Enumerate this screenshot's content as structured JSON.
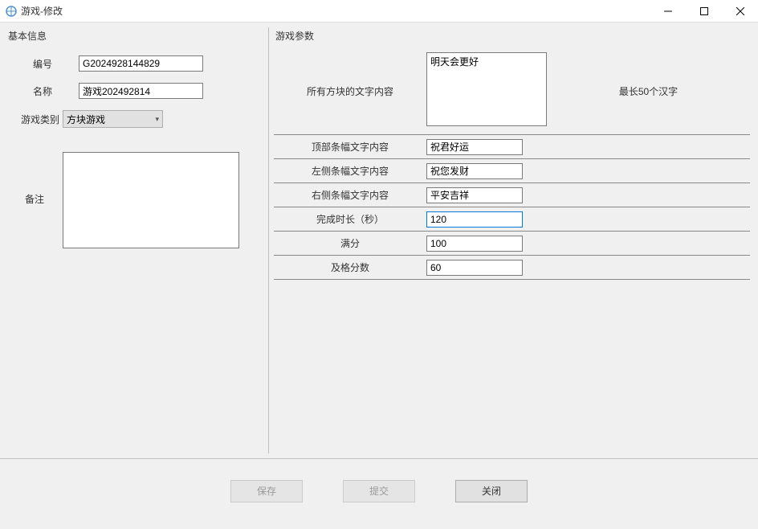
{
  "window": {
    "title": "游戏-修改"
  },
  "basicInfo": {
    "legend": "基本信息",
    "idLabel": "编号",
    "idValue": "G2024928144829",
    "nameLabel": "名称",
    "nameValue": "游戏202492814",
    "categoryLabel": "游戏类别",
    "categoryValue": "方块游戏",
    "remarksLabel": "备注",
    "remarksValue": ""
  },
  "gameParams": {
    "legend": "游戏参数",
    "allBlocksLabel": "所有方块的文字内容",
    "allBlocksValue": "明天会更好",
    "maxNote": "最长50个汉字",
    "topBannerLabel": "顶部条幅文字内容",
    "topBannerValue": "祝君好运",
    "leftBannerLabel": "左侧条幅文字内容",
    "leftBannerValue": "祝您发财",
    "rightBannerLabel": "右侧条幅文字内容",
    "rightBannerValue": "平安吉祥",
    "durationLabel": "完成时长（秒）",
    "durationValue": "120",
    "fullScoreLabel": "满分",
    "fullScoreValue": "100",
    "passScoreLabel": "及格分数",
    "passScoreValue": "60"
  },
  "buttons": {
    "save": "保存",
    "submit": "提交",
    "close": "关闭"
  }
}
